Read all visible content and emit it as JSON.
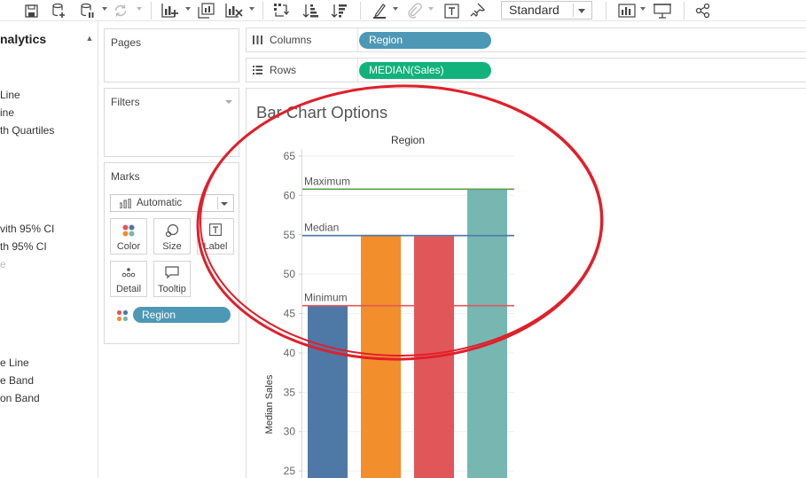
{
  "toolbar": {
    "view_mode": "Standard",
    "icons": [
      "save-icon",
      "new-data-source-icon",
      "pause-updates-icon",
      "refresh-icon",
      "new-worksheet-icon",
      "duplicate-sheet-icon",
      "clear-sheet-icon",
      "swap-rows-columns-icon",
      "sort-ascending-icon",
      "sort-descending-icon",
      "highlight-icon",
      "group-members-icon",
      "show-mark-labels-icon",
      "fix-axes-icon",
      "show-me-icon",
      "presentation-mode-icon",
      "share-icon"
    ]
  },
  "analytics": {
    "title": "nalytics",
    "items": [
      {
        "label": "Line",
        "dim": false
      },
      {
        "label": "ine",
        "dim": false
      },
      {
        "label": "th Quartiles",
        "dim": false
      },
      {
        "label": "vith 95% CI",
        "dim": false
      },
      {
        "label": "th 95% CI",
        "dim": false
      },
      {
        "label": "e",
        "dim": true
      },
      {
        "label": "e Line",
        "dim": false
      },
      {
        "label": "e Band",
        "dim": false
      },
      {
        "label": "on Band",
        "dim": false
      }
    ]
  },
  "cards": {
    "pages_title": "Pages",
    "filters_title": "Filters",
    "marks_title": "Marks",
    "mark_type": "Automatic",
    "mark_buttons": {
      "color": "Color",
      "size": "Size",
      "label": "Label",
      "detail": "Detail",
      "tooltip": "Tooltip"
    },
    "marks_pill": "Region"
  },
  "shelves": {
    "columns_label": "Columns",
    "columns_pill": "Region",
    "rows_label": "Rows",
    "rows_pill": "MEDIAN(Sales)"
  },
  "sheet_title": "Bar Chart Options",
  "colors": {
    "dimension_pill": "#4d98b5",
    "measure_pill": "#11b27b",
    "annotation_red": "#e0202a"
  },
  "chart_data": {
    "type": "bar",
    "header": "Region",
    "ylabel": "Median Sales",
    "ylim_visible": [
      24,
      65
    ],
    "yticks": [
      25,
      30,
      35,
      40,
      45,
      50,
      55,
      60,
      65
    ],
    "categories": [
      "",
      "",
      "",
      ""
    ],
    "values": [
      46,
      55,
      54.8,
      60.8
    ],
    "bar_colors": [
      "#4e79a7",
      "#f28e2b",
      "#e15759",
      "#76b7b2"
    ],
    "reference_lines": [
      {
        "label": "Maximum",
        "value": 60.8,
        "color": "#59a14f"
      },
      {
        "label": "Median",
        "value": 54.9,
        "color": "#4e79a7"
      },
      {
        "label": "Minimum",
        "value": 46.0,
        "color": "#e15759"
      }
    ],
    "grid": true
  }
}
